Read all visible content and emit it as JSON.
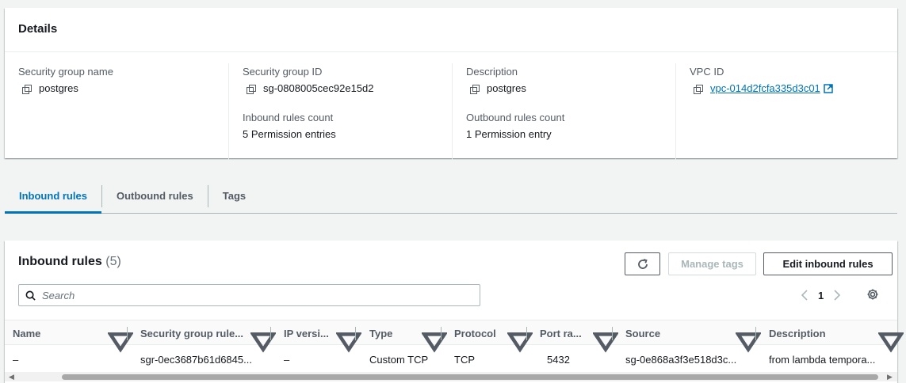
{
  "details": {
    "title": "Details",
    "fields": {
      "sg_name_label": "Security group name",
      "sg_name_value": "postgres",
      "sg_id_label": "Security group ID",
      "sg_id_value": "sg-0808005cec92e15d2",
      "description_label": "Description",
      "description_value": "postgres",
      "vpc_id_label": "VPC ID",
      "vpc_id_value": "vpc-014d2fcfa335d3c01",
      "inbound_count_label": "Inbound rules count",
      "inbound_count_value": "5 Permission entries",
      "outbound_count_label": "Outbound rules count",
      "outbound_count_value": "1 Permission entry"
    }
  },
  "tabs": [
    {
      "label": "Inbound rules",
      "active": true
    },
    {
      "label": "Outbound rules",
      "active": false
    },
    {
      "label": "Tags",
      "active": false
    }
  ],
  "rules": {
    "title": "Inbound rules",
    "count": "(5)",
    "manage_tags_label": "Manage tags",
    "edit_label": "Edit inbound rules",
    "search_placeholder": "Search",
    "page": "1",
    "columns": [
      "Name",
      "Security group rule...",
      "IP versi...",
      "Type",
      "Protocol",
      "Port ra...",
      "Source",
      "Description"
    ],
    "rows": [
      [
        "–",
        "sgr-0ec3687b61d6845...",
        "–",
        "Custom TCP",
        "TCP",
        "5432",
        "sg-0e868a3f3e518d3c...",
        "from lambda tempora..."
      ]
    ]
  },
  "colors": {
    "accent": "#0073bb",
    "text": "#16191f",
    "muted": "#545b64"
  }
}
